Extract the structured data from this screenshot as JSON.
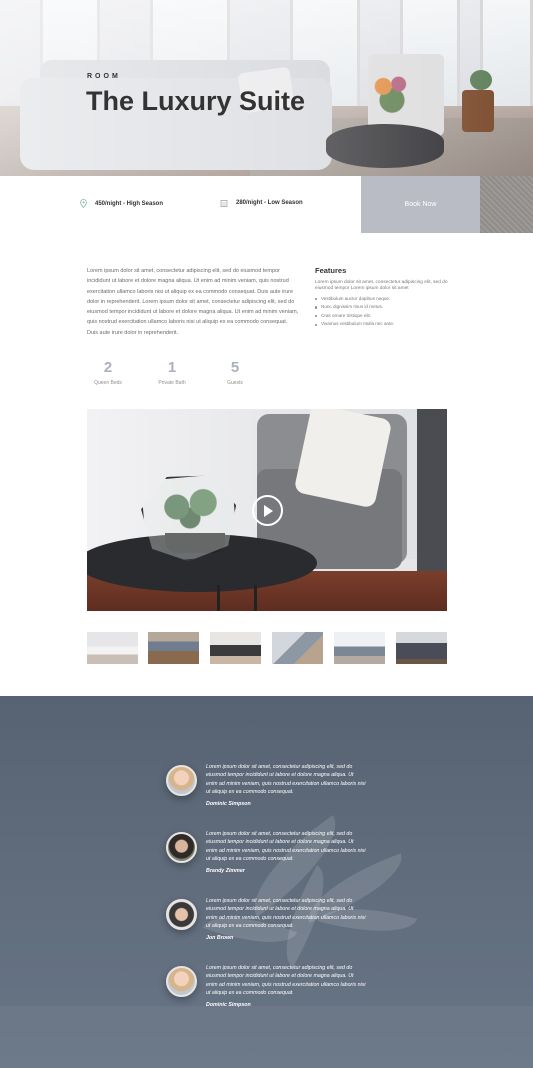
{
  "hero": {
    "eyebrow": "ROOM",
    "title": "The Luxury Suite"
  },
  "info": {
    "high_season": "450/night - High Season",
    "low_season": "280/night - Low Season",
    "book_label": "Book Now"
  },
  "description": "Lorem ipsum dolor sit amet, consectetur adipiscing elit, sed do eiusmod tempor incididunt ut labore et dolore magna aliqua. Ut enim ad minim veniam, quis nostrud exercitation ullamco laboris nisi ut aliquip ex ea commodo consequat. Duis aute irure dolor in reprehenderit. Lorem ipsum dolor sit amet, consectetur adipiscing elit, sed do eiusmod tempor incididunt ut labore et dolore magna aliqua. Ut enim ad minim veniam, quis nostrud exercitation ullamco laboris nisi ut aliquip ex ea commodo consequat. Duis aute irure dolor in reprehenderit.",
  "features": {
    "title": "Features",
    "intro": "Lorem ipsum dolor sit amet, consectetur adipiscing elit, sed do eiusmod tempor Lorem ipsum dolor sit amet",
    "items": [
      "Vestibulum auctor dapibus neque.",
      "Nunc dignissim risus id metus.",
      "Cras ornare tristique elit.",
      "Vivamus vestibulum ntulla nec ante."
    ]
  },
  "stats": [
    {
      "value": "2",
      "label": "Queen Beds"
    },
    {
      "value": "1",
      "label": "Private Bath"
    },
    {
      "value": "5",
      "label": "Guests"
    }
  ],
  "video": {
    "play_icon": "play-icon"
  },
  "testimonials": [
    {
      "text": "Lorem ipsum dolor sit amet, consectetur adipiscing elit, sed do eiusmod tempor incididunt ut labore et dolore magna aliqua. Ut enim ad minim veniam, quis nostrud exercitation ullamco laboris nisi ut aliquip ex ea commodo consequat.",
      "name": "Dominic Simpson"
    },
    {
      "text": "Lorem ipsum dolor sit amet, consectetur adipiscing elit, sed do eiusmod tempor incididunt ut labore et dolore magna aliqua. Ut enim ad minim veniam, quis nostrud exercitation ullamco laboris nisi ut aliquip ex ea commodo consequat.",
      "name": "Brandy Zimmer"
    },
    {
      "text": "Lorem ipsum dolor sit amet, consectetur adipiscing elit, sed do eiusmod tempor incididunt ut labore et dolore magna aliqua. Ut enim ad minim veniam, quis nostrud exercitation ullamco laboris nisi ut aliquip ex ea commodo consequat.",
      "name": "Jon Brown"
    },
    {
      "text": "Lorem ipsum dolor sit amet, consectetur adipiscing elit, sed do eiusmod tempor incididunt ut labore et dolore magna aliqua. Ut enim ad minim veniam, quis nostrud exercitation ullamco laboris nisi ut aliquip ex ea commodo consequat.",
      "name": "Dominic Simpson"
    }
  ],
  "colors": {
    "accent": "#b9bcc5",
    "stat_number": "#aab2bd",
    "testimonial_bg": "#5f6b7a"
  }
}
